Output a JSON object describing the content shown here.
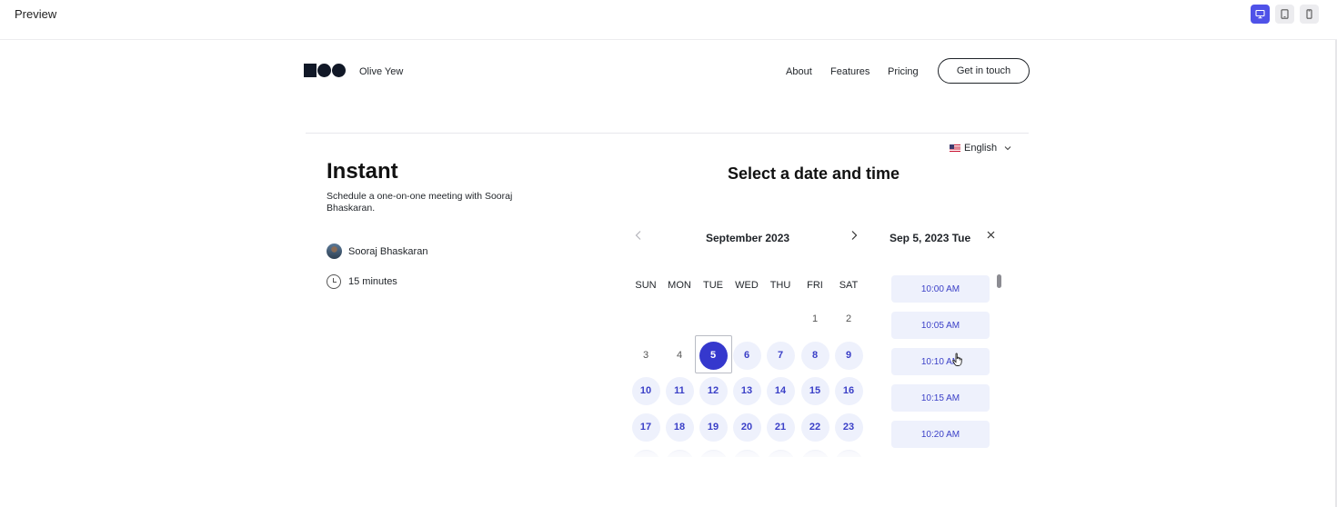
{
  "topbar": {
    "title": "Preview",
    "devices": [
      {
        "name": "desktop-icon",
        "active": true
      },
      {
        "name": "tablet-icon",
        "active": false
      },
      {
        "name": "mobile-icon",
        "active": false
      }
    ]
  },
  "header": {
    "brand": "Olive Yew",
    "nav": {
      "about": "About",
      "features": "Features",
      "pricing": "Pricing"
    },
    "cta": "Get in touch"
  },
  "language": {
    "label": "English",
    "flag": "us-flag-icon"
  },
  "meeting": {
    "title": "Instant",
    "description": "Schedule a one-on-one meeting with Sooraj Bhaskaran.",
    "host": "Sooraj Bhaskaran",
    "duration": "15 minutes"
  },
  "calendar": {
    "heading": "Select a date and time",
    "month": "September 2023",
    "weekdays": [
      "SUN",
      "MON",
      "TUE",
      "WED",
      "THU",
      "FRI",
      "SAT"
    ],
    "weeks": [
      [
        null,
        null,
        null,
        null,
        null,
        "1",
        "2"
      ],
      [
        "3",
        "4",
        "5",
        "6",
        "7",
        "8",
        "9"
      ],
      [
        "10",
        "11",
        "12",
        "13",
        "14",
        "15",
        "16"
      ],
      [
        "17",
        "18",
        "19",
        "20",
        "21",
        "22",
        "23"
      ]
    ],
    "unavailable": [
      "1",
      "2",
      "3",
      "4"
    ],
    "selected": "5"
  },
  "slots": {
    "date": "Sep 5, 2023 Tue",
    "times": [
      "10:00 AM",
      "10:05 AM",
      "10:10 AM",
      "10:15 AM",
      "10:20 AM"
    ]
  },
  "colors": {
    "accent": "#3538cd",
    "slot_bg": "#eef1fc",
    "slot_text": "#3a3fc7",
    "device_active": "#4f52e8"
  }
}
